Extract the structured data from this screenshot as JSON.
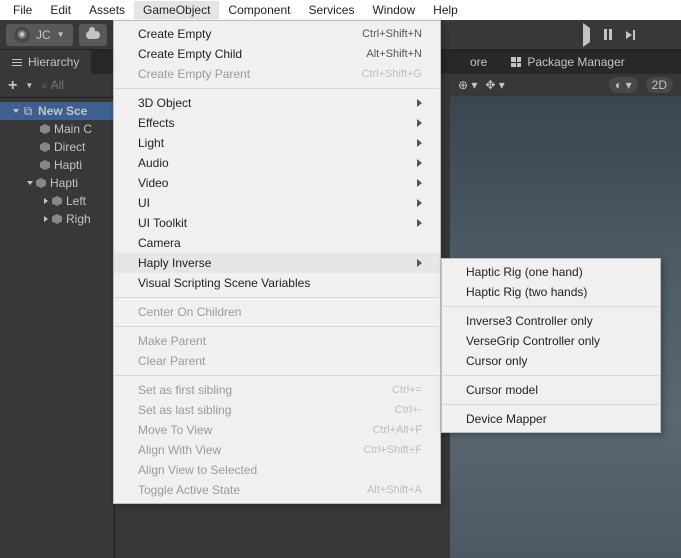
{
  "menubar": {
    "items": [
      "File",
      "Edit",
      "Assets",
      "GameObject",
      "Component",
      "Services",
      "Window",
      "Help"
    ],
    "active_index": 3
  },
  "toolbar": {
    "user_initials": "JC"
  },
  "tabs": {
    "hierarchy": "Hierarchy",
    "ore_stub": "ore",
    "package_manager": "Package Manager"
  },
  "hierarchy_bar": {
    "search_placeholder": "All"
  },
  "scene_toolbar": {
    "mode_2d": "2D"
  },
  "hierarchy": {
    "scene": "New Sce",
    "nodes": [
      {
        "label": "Main C",
        "indent": 40
      },
      {
        "label": "Direct",
        "indent": 40
      },
      {
        "label": "Hapti",
        "indent": 40
      },
      {
        "label": "Hapti",
        "indent": 40,
        "expandable": true
      },
      {
        "label": "Left",
        "indent": 56
      },
      {
        "label": "Righ",
        "indent": 56
      }
    ]
  },
  "menu_gameobject": [
    {
      "label": "Create Empty",
      "shortcut": "Ctrl+Shift+N"
    },
    {
      "label": "Create Empty Child",
      "shortcut": "Alt+Shift+N"
    },
    {
      "label": "Create Empty Parent",
      "shortcut": "Ctrl+Shift+G",
      "disabled": true
    },
    {
      "sep": true
    },
    {
      "label": "3D Object",
      "submenu": true
    },
    {
      "label": "Effects",
      "submenu": true
    },
    {
      "label": "Light",
      "submenu": true
    },
    {
      "label": "Audio",
      "submenu": true
    },
    {
      "label": "Video",
      "submenu": true
    },
    {
      "label": "UI",
      "submenu": true
    },
    {
      "label": "UI Toolkit",
      "submenu": true
    },
    {
      "label": "Camera"
    },
    {
      "label": "Haply Inverse",
      "submenu": true,
      "highlight": true
    },
    {
      "label": "Visual Scripting Scene Variables"
    },
    {
      "sep": true
    },
    {
      "label": "Center On Children",
      "disabled": true
    },
    {
      "sep": true
    },
    {
      "label": "Make Parent",
      "disabled": true
    },
    {
      "label": "Clear Parent",
      "disabled": true
    },
    {
      "sep": true
    },
    {
      "label": "Set as first sibling",
      "shortcut": "Ctrl+=",
      "disabled": true
    },
    {
      "label": "Set as last sibling",
      "shortcut": "Ctrl+-",
      "disabled": true
    },
    {
      "label": "Move To View",
      "shortcut": "Ctrl+Alt+F",
      "disabled": true
    },
    {
      "label": "Align With View",
      "shortcut": "Ctrl+Shift+F",
      "disabled": true
    },
    {
      "label": "Align View to Selected",
      "disabled": true
    },
    {
      "label": "Toggle Active State",
      "shortcut": "Alt+Shift+A",
      "disabled": true
    }
  ],
  "submenu_haply": [
    {
      "label": "Haptic Rig (one hand)"
    },
    {
      "label": "Haptic Rig (two hands)"
    },
    {
      "sep": true
    },
    {
      "label": "Inverse3 Controller only"
    },
    {
      "label": "VerseGrip Controller only"
    },
    {
      "label": "Cursor only"
    },
    {
      "sep": true
    },
    {
      "label": "Cursor model"
    },
    {
      "sep": true
    },
    {
      "label": "Device Mapper"
    }
  ]
}
